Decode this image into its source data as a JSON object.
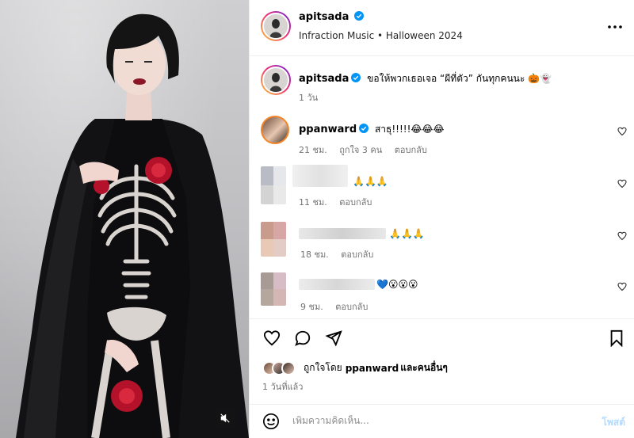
{
  "header": {
    "username": "apitsada",
    "subtitle": "Infraction Music • Halloween 2024",
    "more_icon": "more-horizontal-icon"
  },
  "caption": {
    "username": "apitsada",
    "text": "ขอให้พวกเธอเจอ “ผีที่ตัว” กันทุกคนนะ 🎃👻",
    "time": "1 วัน"
  },
  "comments": [
    {
      "username": "ppanward",
      "text": "สาธุ!!!!!😂😂😂",
      "time": "21 ชม.",
      "likes": "ถูกใจ 3 คน",
      "reply": "ตอบกลับ"
    },
    {
      "username": "",
      "text": "🙏🙏🙏",
      "time": "11 ชม.",
      "reply": "ตอบกลับ"
    },
    {
      "username": "",
      "text": "🙏🙏🙏",
      "time": "18 ชม.",
      "reply": "ตอบกลับ"
    },
    {
      "username": "",
      "text": "💙😮😮😮",
      "time": "9 ชม.",
      "reply": "ตอบกลับ"
    }
  ],
  "likes": {
    "prefix": "ถูกใจโดย ",
    "user": "ppanward",
    "suffix": " และคนอื่นๆ"
  },
  "post_time": "1 วันที่แล้ว",
  "comment_box": {
    "placeholder": "เพิ่มความคิดเห็น...",
    "post_label": "โพสต์"
  },
  "colors": {
    "verified": "#0095f6",
    "meta": "#737373",
    "post_disabled": "#b3dbff"
  }
}
